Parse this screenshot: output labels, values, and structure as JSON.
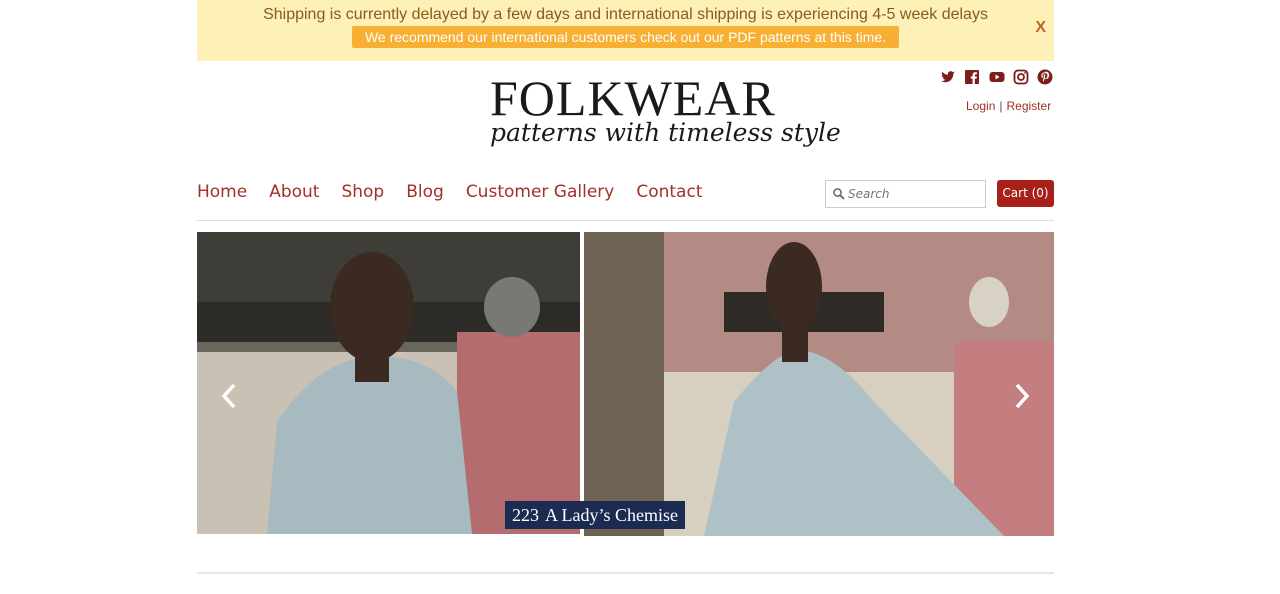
{
  "banner": {
    "line1": "Shipping is currently delayed by a few days and international shipping is experiencing 4-5 week delays",
    "line2": "We recommend our international customers check out our PDF patterns at this time.",
    "close_label": "X"
  },
  "brand": {
    "name": "FOLKWEAR",
    "tagline": "patterns with timeless style"
  },
  "social_icons": [
    "twitter-icon",
    "facebook-icon",
    "youtube-icon",
    "instagram-icon",
    "pinterest-icon"
  ],
  "account": {
    "login": "Login",
    "separator": "|",
    "register": "Register"
  },
  "nav": {
    "items": [
      "Home",
      "About",
      "Shop",
      "Blog",
      "Customer Gallery",
      "Contact"
    ]
  },
  "search": {
    "placeholder": "Search",
    "value": ""
  },
  "cart": {
    "label": "Cart (0)"
  },
  "slideshow": {
    "caption_number": "223",
    "caption_title": "A Lady’s Chemise"
  },
  "colors": {
    "accent": "#a23027",
    "banner_bg": "#fdf1b8",
    "banner_highlight": "#f7b034",
    "caption_bg": "#1c2b52"
  }
}
